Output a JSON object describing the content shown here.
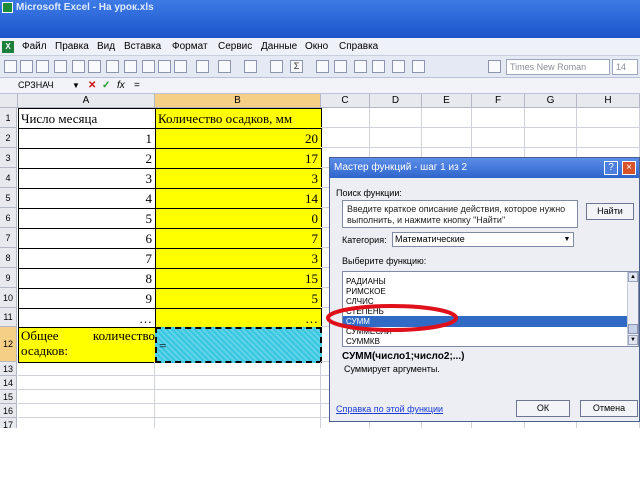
{
  "window": {
    "title": "Microsoft Excel - На урок.xls"
  },
  "menu": [
    "Файл",
    "Правка",
    "Вид",
    "Вставка",
    "Формат",
    "Сервис",
    "Данные",
    "Окно",
    "Справка"
  ],
  "toolbar": {
    "font_name": "Times New Roman",
    "font_size": "14",
    "sigma": "Σ"
  },
  "formula_bar": {
    "name_box": "СРЗНАЧ",
    "fx": "fx",
    "formula": "="
  },
  "grid": {
    "columns": [
      "A",
      "B",
      "C",
      "D",
      "E",
      "F",
      "G",
      "H"
    ],
    "rows": [
      "1",
      "2",
      "3",
      "4",
      "5",
      "6",
      "7",
      "8",
      "9",
      "10",
      "11",
      "12",
      "13",
      "14",
      "15",
      "16",
      "17"
    ],
    "header_a": "Число месяца",
    "header_b": "Количество осадков, мм",
    "days": [
      "1",
      "2",
      "3",
      "4",
      "5",
      "6",
      "7",
      "8",
      "9",
      "…"
    ],
    "rain": [
      "20",
      "17",
      "3",
      "14",
      "0",
      "7",
      "3",
      "15",
      "5",
      "…"
    ],
    "total_label_line1": "Общее количество",
    "total_label_line2": "осадков:",
    "total_value": "="
  },
  "dialog": {
    "title": "Мастер функций - шаг 1 из 2",
    "help_btn": "?",
    "close_btn": "×",
    "search_label": "Поиск функции:",
    "search_placeholder_line1": "Введите краткое описание действия, которое нужно",
    "search_placeholder_line2": "выполнить, и нажмите кнопку \"Найти\"",
    "find_button": "Найти",
    "category_label": "Категория:",
    "category_value": "Математические",
    "select_label": "Выберите функцию:",
    "functions": [
      "РАДИАНЫ",
      "РИМСКОЕ",
      "СЛЧИС",
      "СТЕПЕНЬ",
      "СУММ",
      "СУММЕСЛИ",
      "СУММКВ"
    ],
    "selected_index": 4,
    "signature": "СУММ(число1;число2;...)",
    "description": "Суммирует аргументы.",
    "help_link": "Справка по этой функции",
    "ok_button": "ОК",
    "cancel_button": "Отмена"
  },
  "colors": {
    "highlight": "#ffff00",
    "selection": "#316ac5",
    "annotation": "#e0101a"
  }
}
